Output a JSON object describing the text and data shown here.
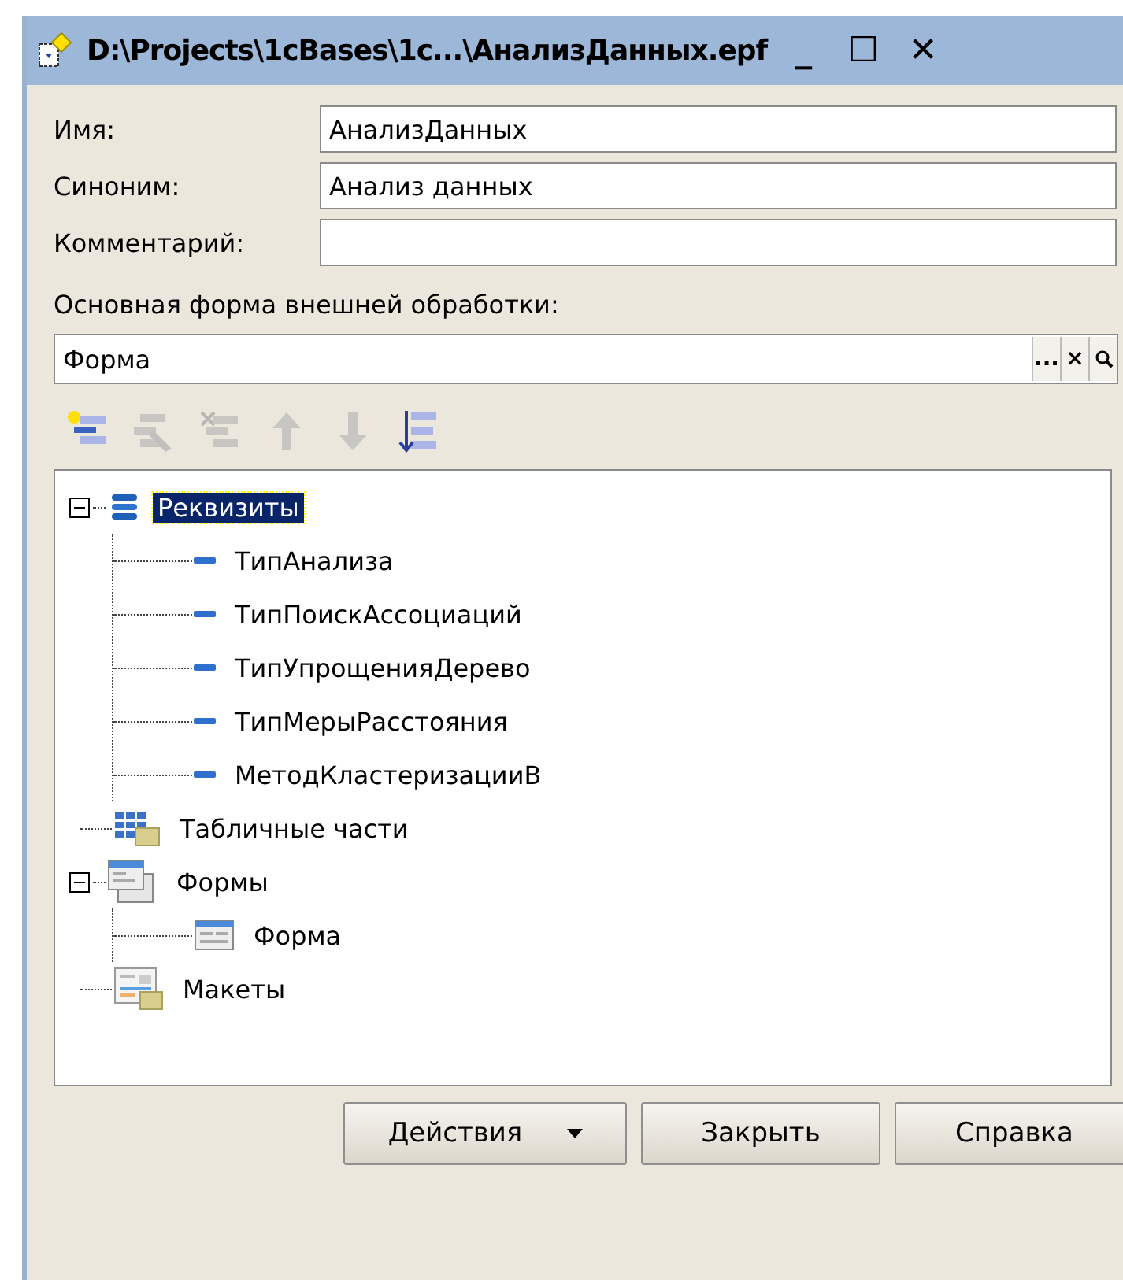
{
  "window": {
    "title": "D:\\Projects\\1cBases\\1c...\\АнализДанных.epf",
    "controls": [
      "_",
      "☐",
      "✕"
    ]
  },
  "fields": [
    {
      "label": "Имя:",
      "value": "АнализДанных"
    },
    {
      "label": "Синоним:",
      "value": "Анализ данных"
    },
    {
      "label": "Комментарий:"
    }
  ],
  "main_form": {
    "label": "Основная форма внешней обработки:",
    "value": "Форма",
    "buttons": [
      "...",
      "×"
    ]
  },
  "toolbar": [
    {
      "kind": "add",
      "disabled": false
    },
    {
      "kind": "edit",
      "disabled": true
    },
    {
      "kind": "delete",
      "disabled": true
    },
    {
      "kind": "up",
      "disabled": true
    },
    {
      "kind": "down",
      "disabled": true
    },
    {
      "kind": "sort",
      "disabled": false
    }
  ],
  "tree": [
    {
      "label": "Реквизиты",
      "kind": "attributes",
      "selected": true,
      "expanded": true,
      "children": [
        {
          "label": "ТипАнализа",
          "kind": "attribute",
          "selected": false
        },
        {
          "label": "ТипПоискАссоциаций",
          "kind": "attribute",
          "selected": false
        },
        {
          "label": "ТипУпрощенияДерево",
          "kind": "attribute",
          "selected": false
        },
        {
          "label": "ТипМерыРасстояния",
          "kind": "attribute",
          "selected": false
        },
        {
          "label": "МетодКластеризацииВ",
          "kind": "attribute",
          "selected": false
        }
      ]
    },
    {
      "label": "Табличные части",
      "kind": "tables",
      "selected": false
    },
    {
      "label": "Формы",
      "kind": "forms",
      "selected": false,
      "expanded": true,
      "children": [
        {
          "label": "Форма",
          "kind": "form",
          "selected": false
        }
      ]
    },
    {
      "label": "Макеты",
      "kind": "templates",
      "selected": false
    }
  ],
  "buttons": [
    {
      "label": "Действия",
      "dropdown": true
    },
    {
      "label": "Закрыть",
      "dropdown": false
    },
    {
      "label": "Справка",
      "dropdown": false
    }
  ]
}
